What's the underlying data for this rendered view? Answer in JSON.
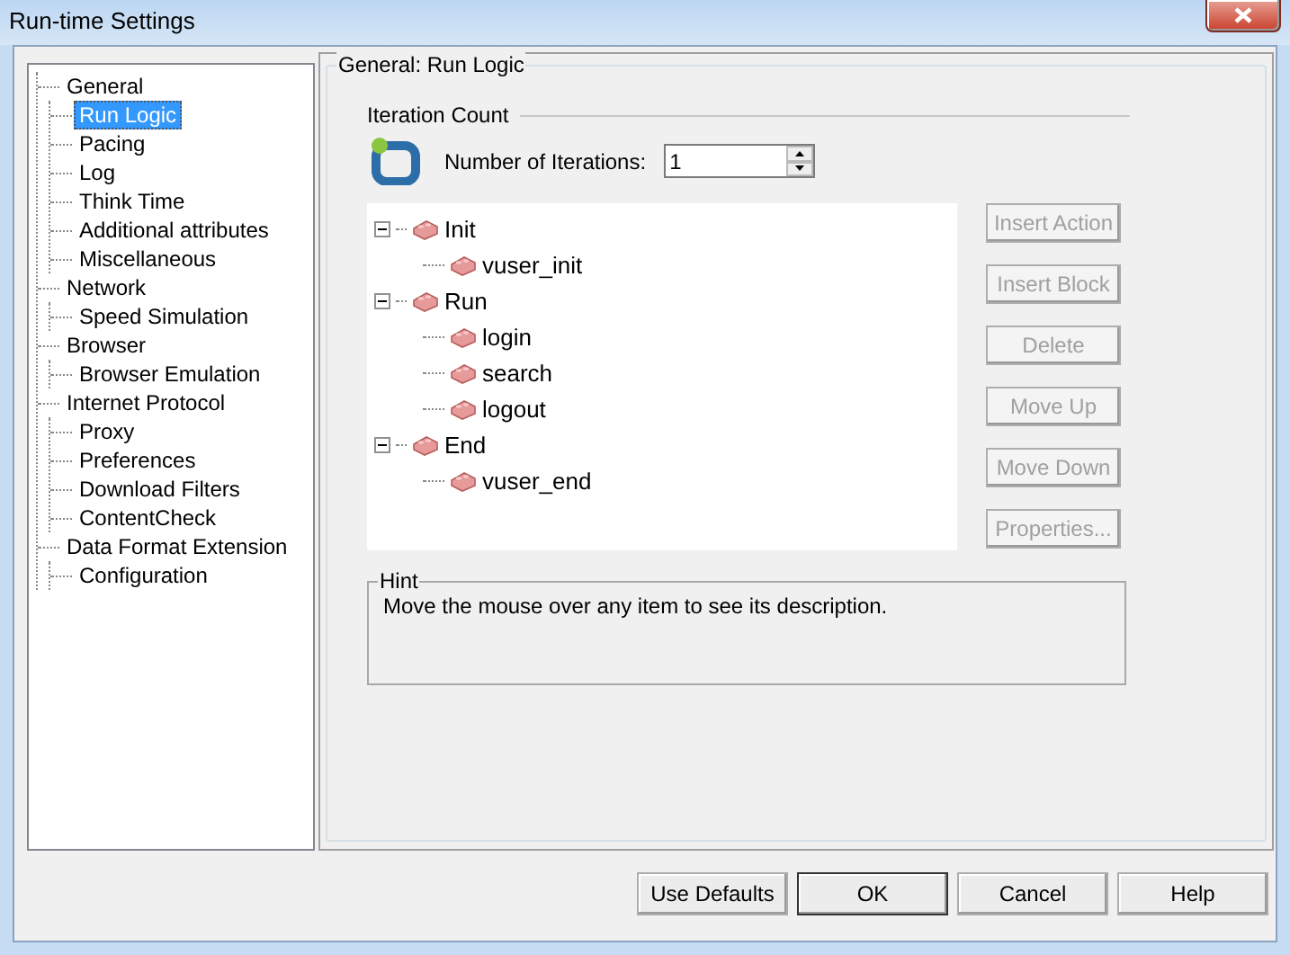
{
  "window": {
    "title": "Run-time Settings"
  },
  "categories": [
    {
      "label": "General",
      "selected": false,
      "children": [
        {
          "label": "Run Logic",
          "selected": true
        },
        {
          "label": "Pacing",
          "selected": false
        },
        {
          "label": "Log",
          "selected": false
        },
        {
          "label": "Think Time",
          "selected": false
        },
        {
          "label": "Additional attributes",
          "selected": false
        },
        {
          "label": "Miscellaneous",
          "selected": false
        }
      ]
    },
    {
      "label": "Network",
      "selected": false,
      "children": [
        {
          "label": "Speed Simulation",
          "selected": false
        }
      ]
    },
    {
      "label": "Browser",
      "selected": false,
      "children": [
        {
          "label": "Browser Emulation",
          "selected": false
        }
      ]
    },
    {
      "label": "Internet Protocol",
      "selected": false,
      "children": [
        {
          "label": "Proxy",
          "selected": false
        },
        {
          "label": "Preferences",
          "selected": false
        },
        {
          "label": "Download Filters",
          "selected": false
        },
        {
          "label": "ContentCheck",
          "selected": false
        }
      ]
    },
    {
      "label": "Data Format Extension",
      "selected": false,
      "children": [
        {
          "label": "Configuration",
          "selected": false
        }
      ]
    }
  ],
  "panel": {
    "title": "General: Run Logic",
    "iteration_group": "Iteration Count",
    "iterations_label": "Number of Iterations:",
    "iterations_value": "1",
    "blocks": [
      {
        "label": "Init",
        "expanded": true,
        "children": [
          {
            "label": "vuser_init"
          }
        ]
      },
      {
        "label": "Run",
        "expanded": true,
        "children": [
          {
            "label": "login"
          },
          {
            "label": "search"
          },
          {
            "label": "logout"
          }
        ]
      },
      {
        "label": "End",
        "expanded": true,
        "children": [
          {
            "label": "vuser_end"
          }
        ]
      }
    ],
    "actions": [
      {
        "label": "Insert Action",
        "disabled": true
      },
      {
        "label": "Insert Block",
        "disabled": true
      },
      {
        "label": "Delete",
        "disabled": true
      },
      {
        "label": "Move Up",
        "disabled": true
      },
      {
        "label": "Move Down",
        "disabled": true
      },
      {
        "label": "Properties...",
        "disabled": true
      }
    ],
    "hint": {
      "title": "Hint",
      "text": "Move the mouse over any item to see its description."
    }
  },
  "buttons": [
    {
      "label": "Use Defaults",
      "default": false
    },
    {
      "label": "OK",
      "default": true
    },
    {
      "label": "Cancel",
      "default": false
    },
    {
      "label": "Help",
      "default": false
    }
  ]
}
